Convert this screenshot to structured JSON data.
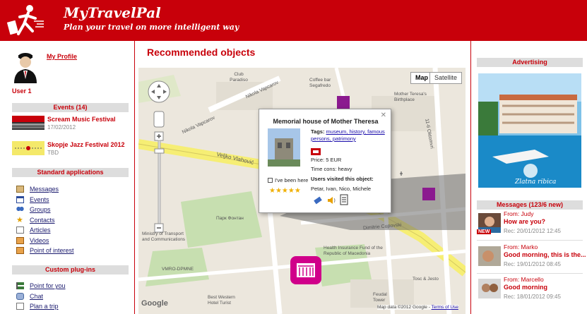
{
  "header": {
    "brand": "MyTravelPal",
    "tagline": "Plan your travel on more intelligent way"
  },
  "profile": {
    "link": "My Profile",
    "user": "User 1"
  },
  "events": {
    "heading": "Events (14)",
    "items": [
      {
        "title": "Scream Music  Festival",
        "date": "17/02/2012"
      },
      {
        "title": "Skopje Jazz Festival 2012",
        "date": "TBD"
      }
    ]
  },
  "standard_apps": {
    "heading": "Standard applications",
    "items": [
      {
        "label": "Messages",
        "icon": "envelope-icon"
      },
      {
        "label": "Events",
        "icon": "calendar-icon"
      },
      {
        "label": "Groups",
        "icon": "people-icon"
      },
      {
        "label": "Contacts",
        "icon": "star-contact-icon"
      },
      {
        "label": "Articles",
        "icon": "document-icon"
      },
      {
        "label": "Videos",
        "icon": "film-icon"
      },
      {
        "label": "Point of interest",
        "icon": "poi-icon"
      }
    ]
  },
  "custom_plugins": {
    "heading": "Custom plug-ins",
    "items": [
      {
        "label": "Point for you",
        "icon": "signpost-icon"
      },
      {
        "label": "Chat",
        "icon": "chat-icon"
      },
      {
        "label": "Plan a trip",
        "icon": "trip-icon"
      }
    ]
  },
  "main": {
    "title": "Recommended objects",
    "map": {
      "type_map": "Map",
      "type_satellite": "Satellite",
      "google": "Google",
      "attribution": "Map data ©2012 Google - ",
      "terms": "Terms of Use",
      "labels": {
        "club": "Club Paradiso",
        "street1": "Nikola Vapcarov",
        "street2": "Nikola Vapcarov",
        "street3": "Veljko Vlahović",
        "street4": "Dimitrie Cupovski",
        "street5": "11-ti Oktomvri",
        "coffee": "Coffee bar Segafredo",
        "mtbirth": "Mother Teresa's Birthplace",
        "ministry": "Ministry of Transport and Communications",
        "health": "Health Insurance Fund of the Republic of Macedonia",
        "vmro": "VMRO-DPMNE",
        "hotel": "Best Western Hotel Turist",
        "feudal": "Feudal Tower",
        "park": "Парк Фонтан",
        "tobos": "Tosc & Jesto"
      },
      "popup": {
        "title": "Memorial house of Mother Theresa",
        "tags_label": "Tags:",
        "tags": "museum, history, famous persons, patrimony",
        "price": "Price: 5 EUR",
        "time_cons": "Time cons: heavy",
        "users_label": "Users visited this object:",
        "users": "Petar, Ivan, Nico, Michele",
        "ive_been": "I've been here",
        "stars": "★★★★★"
      }
    }
  },
  "right": {
    "advertising": "Advertising",
    "messages_heading": "Messages (123/6 new)",
    "messages": [
      {
        "from": "From: Judy",
        "subject": "How are you?",
        "date": "Rec: 20/01/2012 12:45",
        "new": "NEW"
      },
      {
        "from": "From: Marko",
        "subject": "Good morning, this is the...",
        "date": "Rec: 19/01/2012 08:45"
      },
      {
        "from": "From: Marcello",
        "subject": "Good morning",
        "date": "Rec: 18/01/2012 09:45"
      }
    ]
  },
  "colors": {
    "brand_red": "#c8000a",
    "map_bg": "#ece7dd",
    "poi_purple": "#8b1a8f"
  }
}
